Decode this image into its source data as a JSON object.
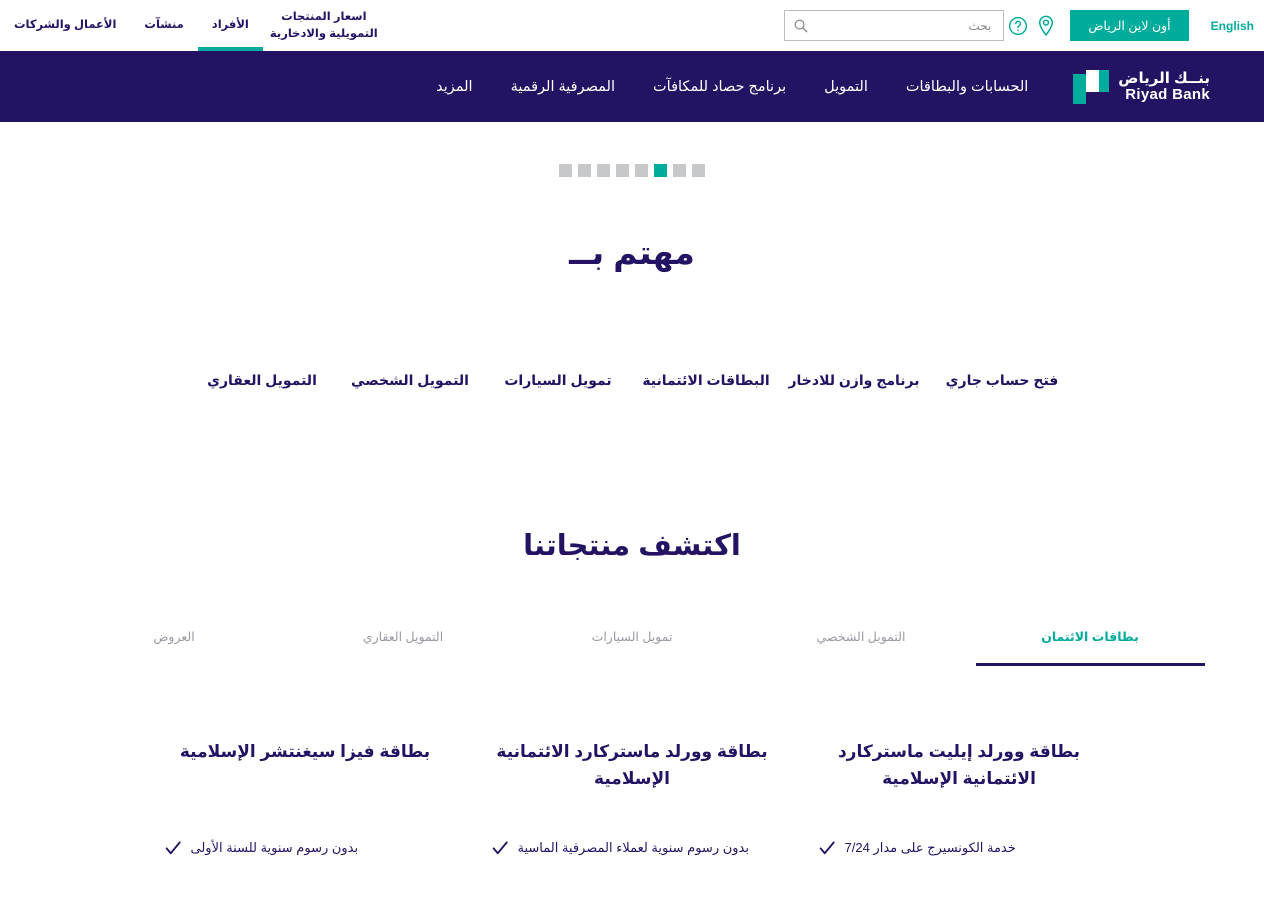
{
  "utility": {
    "language_link": "English",
    "online_button": "أون لاين الرياض",
    "location_icon": "location-pin-icon",
    "help_icon": "question-mark-icon",
    "search": {
      "placeholder": "بحث",
      "value": "",
      "icon": "search-icon"
    },
    "nav": [
      {
        "label": "اسعار المنتجات التمويلية والادخارية",
        "active": false,
        "two_line": true
      },
      {
        "label": "الأفراد",
        "active": true,
        "two_line": false
      },
      {
        "label": "منشآت",
        "active": false,
        "two_line": false
      },
      {
        "label": "الأعمال والشركات",
        "active": false,
        "two_line": false
      }
    ]
  },
  "brand": {
    "name_ar": "بنــك الرياض",
    "name_en": "Riyad Bank",
    "logo_icon": "riyad-bank-logo-icon"
  },
  "main_nav": {
    "items": [
      {
        "label": "الحسابات والبطاقات"
      },
      {
        "label": "التمويل"
      },
      {
        "label": "برنامج حصاد للمكافآت"
      },
      {
        "label": "المصرفية الرقمية"
      },
      {
        "label": "المزيد"
      }
    ]
  },
  "carousel": {
    "slide_count": 8,
    "active_index": 2
  },
  "interests": {
    "title": "مهتم بــ",
    "items": [
      {
        "label": "فتح حساب جاري"
      },
      {
        "label": "برنامج وازن للادخار"
      },
      {
        "label": "البطاقات الائتمانية"
      },
      {
        "label": "تمويل السيارات"
      },
      {
        "label": "التمويل الشخصي"
      },
      {
        "label": "التمويل العقاري"
      }
    ]
  },
  "products": {
    "title": "اكتشف منتجاتنا",
    "tabs": [
      {
        "label": "بطاقات الائتمان",
        "active": true
      },
      {
        "label": "التمويل الشخصي",
        "active": false
      },
      {
        "label": "تمويل السيارات",
        "active": false
      },
      {
        "label": "التمويل العقاري",
        "active": false
      },
      {
        "label": "العروض",
        "active": false
      }
    ],
    "cards": [
      {
        "title": "بطاقة وورلد إيليت ماستركارد الائتمانية الإسلامية",
        "features": [
          "خدمة الكونسيرج على مدار 7/24"
        ]
      },
      {
        "title": "بطاقة وورلد ماستركارد الائتمانية الإسلامية",
        "features": [
          "بدون رسوم سنوية لعملاء المصرفية الماسية"
        ]
      },
      {
        "title": "بطاقة فيزا سيغنتشر الإسلامية",
        "features": [
          "بدون رسوم سنوية للسنة الأولى"
        ]
      }
    ]
  },
  "colors": {
    "brand_purple": "#241263",
    "brand_teal": "#00ac9b",
    "dot_inactive": "#c6c8ca",
    "tab_inactive": "#9a9aa6"
  }
}
